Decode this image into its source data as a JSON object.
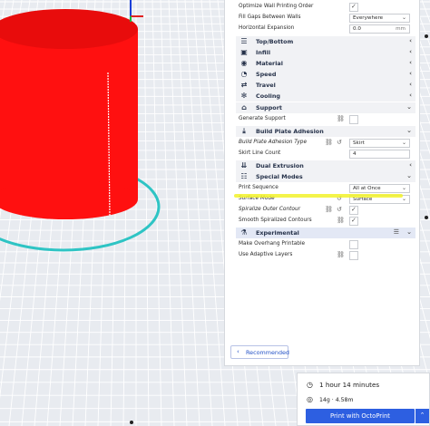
{
  "settings": {
    "rows_top": [
      {
        "label": "Optimize Wall Printing Order",
        "control": "check",
        "checked": true
      },
      {
        "label": "Fill Gaps Between Walls",
        "control": "drop",
        "value": "Everywhere"
      },
      {
        "label": "Horizontal Expansion",
        "control": "text",
        "value": "0.0",
        "unit": "mm"
      }
    ],
    "categories_top": [
      {
        "label": "Top/Bottom",
        "icon": "top-bottom-icon"
      },
      {
        "label": "Infill",
        "icon": "infill-icon"
      },
      {
        "label": "Material",
        "icon": "material-icon"
      },
      {
        "label": "Speed",
        "icon": "speed-icon"
      },
      {
        "label": "Travel",
        "icon": "travel-icon"
      },
      {
        "label": "Cooling",
        "icon": "cooling-icon"
      }
    ],
    "support": {
      "label": "Support",
      "generate_support": "Generate Support"
    },
    "build_plate": {
      "label": "Build Plate Adhesion",
      "type_label": "Build Plate Adhesion Type",
      "type_value": "Skirt",
      "skirt_label": "Skirt Line Count",
      "skirt_value": "4"
    },
    "dual_extrusion": {
      "label": "Dual Extrusion"
    },
    "special_modes": {
      "label": "Special Modes",
      "print_sequence_label": "Print Sequence",
      "print_sequence_value": "All at Once",
      "surface_mode_label": "Surface Mode",
      "surface_mode_value": "Surface",
      "spiralize_label": "Spiralize Outer Contour",
      "smooth_label": "Smooth Spiralized Contours"
    },
    "experimental": {
      "label": "Experimental",
      "overhang_label": "Make Overhang Printable",
      "adaptive_label": "Use Adaptive Layers"
    },
    "recommended_label": "Recommended"
  },
  "print_info": {
    "time": "1 hour 14 minutes",
    "material": "14g · 4.58m",
    "button_label": "Print with OctoPrint"
  },
  "colors": {
    "model": "#ff1010",
    "skirt": "#2ec4c4",
    "accent": "#2d5fe1",
    "highlight": "#f2f22a"
  }
}
